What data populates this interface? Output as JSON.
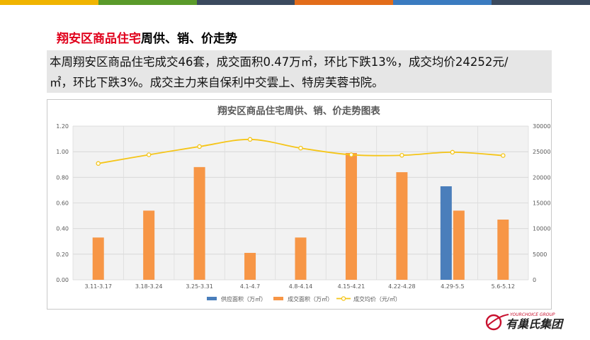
{
  "colors": {
    "topbar": [
      "#f0b400",
      "#5a9a2a",
      "#3b4a5e",
      "#e26c1a",
      "#3a7bc0",
      "#3b4a5e"
    ],
    "heading_highlight": "#e0001b",
    "supply": "#4a7ebb",
    "deal_area": "#f79646",
    "avg_price": "#f5c518"
  },
  "heading": {
    "highlight": "翔安区商品住宅",
    "rest": "周供、销、价走势"
  },
  "summary": {
    "line1": "本周翔安区商品住宅成交46套，成交面积0.47万㎡，环比下跌13%，成交均价24252元/",
    "line2": "㎡，环比下跌3%。成交主力来自保利中交雲上、特房芙蓉书院。"
  },
  "chart_data": {
    "type": "bar",
    "title": "翔安区商品住宅周供、销、价走势图表",
    "categories": [
      "3.11-3.17",
      "3.18-3.24",
      "3.25-3.31",
      "4.1-4.7",
      "4.8-4.14",
      "4.15-4.21",
      "4.22-4.28",
      "4.29-5.5",
      "5.6-5.12"
    ],
    "series": [
      {
        "name": "供应面积（万㎡）",
        "type": "bar",
        "axis": "left",
        "values": [
          0,
          0,
          0,
          0,
          0,
          0,
          0,
          0.73,
          0
        ]
      },
      {
        "name": "成交面积（万㎡）",
        "type": "bar",
        "axis": "left",
        "values": [
          0.33,
          0.54,
          0.88,
          0.21,
          0.33,
          0.99,
          0.84,
          0.54,
          0.47
        ]
      },
      {
        "name": "成交均价（元/㎡）",
        "type": "line",
        "axis": "right",
        "values": [
          22700,
          24400,
          26000,
          27400,
          25700,
          24400,
          24300,
          24900,
          24252
        ]
      }
    ],
    "ylim_left": [
      0,
      1.2
    ],
    "yticks_left": [
      "0.00",
      "0.20",
      "0.40",
      "0.60",
      "0.80",
      "1.00",
      "1.20"
    ],
    "ylim_right": [
      0,
      30000
    ],
    "yticks_right": [
      "0",
      "5000",
      "10000",
      "15000",
      "20000",
      "25000",
      "30000"
    ],
    "grid": true,
    "legend_position": "bottom"
  },
  "logo": {
    "text_cn": "有巢氏集团",
    "text_en": "YOURCHOICE GROUP"
  }
}
